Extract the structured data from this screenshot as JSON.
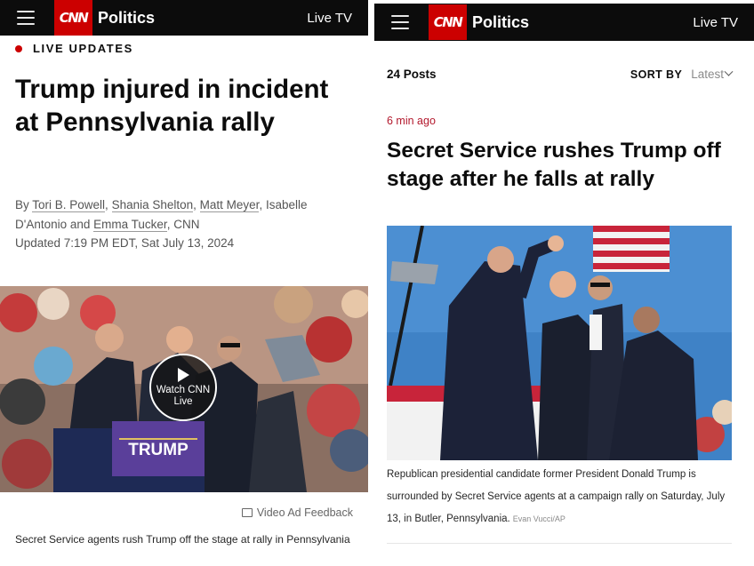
{
  "left": {
    "header": {
      "section": "Politics",
      "live_tv": "Live TV",
      "logo_text": "CNN"
    },
    "live_label": "LIVE UPDATES",
    "headline": "Trump injured in incident at Pennsylvania rally",
    "byline": {
      "prefix": "By ",
      "authors": [
        "Tori B. Powell",
        "Shania Shelton",
        "Matt Meyer",
        "Isabelle D'Antonio",
        "Emma Tucker"
      ],
      "sep_comma": ", ",
      "sep_and": " and ",
      "suffix": ", CNN"
    },
    "updated": "Updated 7:19 PM EDT, Sat July 13, 2024",
    "video": {
      "watch_label": "Watch CNN Live",
      "podium_sign": "TRUMP"
    },
    "ad_feedback": "Video Ad Feedback",
    "caption": "Secret Service agents rush Trump off the stage at rally in Pennsylvania"
  },
  "right": {
    "header": {
      "section": "Politics",
      "live_tv": "Live TV",
      "logo_text": "CNN"
    },
    "posts_count": "24 Posts",
    "sort_label": "SORT BY",
    "sort_value": "Latest",
    "timestamp": "6 min ago",
    "headline": "Secret Service rushes Trump off stage after he falls at rally",
    "caption": "Republican presidential candidate former President Donald Trump is surrounded by Secret Service agents at a campaign rally on Saturday, July 13, in Butler, Pennsylvania.",
    "photo_credit": "Evan Vucci/AP"
  },
  "colors": {
    "brand_red": "#cc0000",
    "header_bg": "#0c0c0c",
    "timestamp_red": "#b3192d"
  }
}
